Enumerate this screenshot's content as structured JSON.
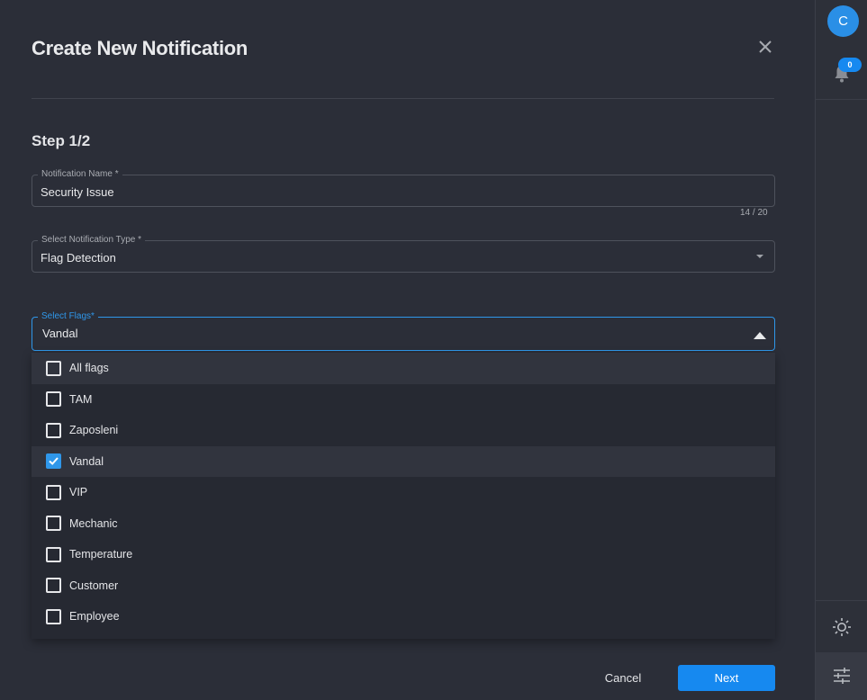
{
  "dialog": {
    "title": "Create New Notification",
    "step": "Step 1/2",
    "name_field": {
      "label": "Notification Name *",
      "value": "Security Issue",
      "counter": "14 / 20"
    },
    "type_field": {
      "label": "Select Notification Type *",
      "value": "Flag Detection"
    },
    "flags_field": {
      "label": "Select Flags*",
      "value": "Vandal",
      "options": [
        {
          "label": "All flags",
          "checked": false
        },
        {
          "label": "TAM",
          "checked": false
        },
        {
          "label": "Zaposleni",
          "checked": false
        },
        {
          "label": "Vandal",
          "checked": true
        },
        {
          "label": "VIP",
          "checked": false
        },
        {
          "label": "Mechanic",
          "checked": false
        },
        {
          "label": "Temperature",
          "checked": false
        },
        {
          "label": "Customer",
          "checked": false
        },
        {
          "label": "Employee",
          "checked": false
        }
      ]
    },
    "cancel_label": "Cancel",
    "next_label": "Next"
  },
  "rail": {
    "avatar_initial": "C",
    "notification_count": "0",
    "icons": [
      "bell-icon",
      "sun-icon",
      "tune-icon"
    ]
  },
  "colors": {
    "accent": "#1689f0",
    "background": "#2b2e38",
    "focus_border": "#2f97ea"
  }
}
